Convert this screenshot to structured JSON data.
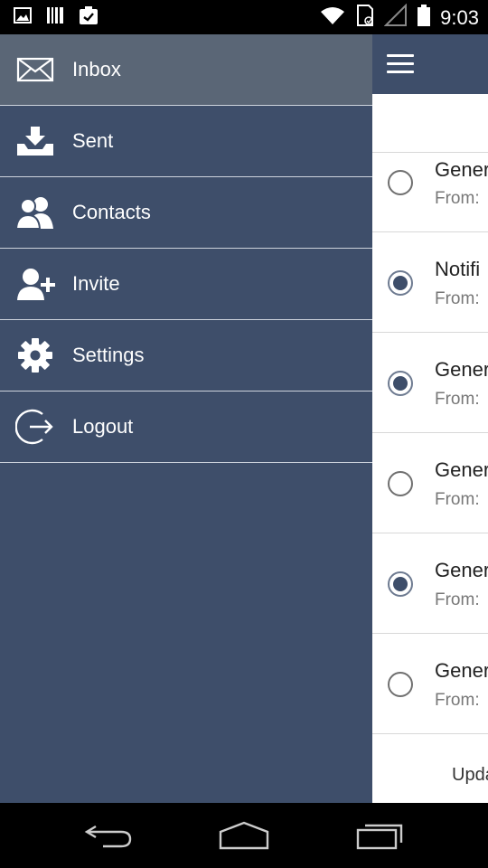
{
  "status_bar": {
    "time": "9:03",
    "left_icons": [
      "image-icon",
      "barcode-icon",
      "clipboard-check-icon"
    ],
    "right_icons": [
      "wifi-icon",
      "sd-card-icon",
      "signal-icon",
      "battery-icon"
    ]
  },
  "drawer": {
    "items": [
      {
        "label": "Inbox",
        "icon": "envelope-icon",
        "active": true
      },
      {
        "label": "Sent",
        "icon": "tray-download-icon",
        "active": false
      },
      {
        "label": "Contacts",
        "icon": "contacts-icon",
        "active": false
      },
      {
        "label": "Invite",
        "icon": "add-user-icon",
        "active": false
      },
      {
        "label": "Settings",
        "icon": "gear-icon",
        "active": false
      },
      {
        "label": "Logout",
        "icon": "logout-icon",
        "active": false
      }
    ]
  },
  "messages": [
    {
      "title": "Gener",
      "from": "From:",
      "checked": false
    },
    {
      "title": "Notifi",
      "from": "From:",
      "checked": true
    },
    {
      "title": "Gener",
      "from": "From:",
      "checked": true
    },
    {
      "title": "Gener",
      "from": "From:",
      "checked": false
    },
    {
      "title": "Gener",
      "from": "From:",
      "checked": true
    },
    {
      "title": "Gener",
      "from": "From:",
      "checked": false
    }
  ],
  "footer": {
    "text": "Upda"
  },
  "colors": {
    "primary": "#3e4e6a",
    "active_item": "#5a6676"
  }
}
